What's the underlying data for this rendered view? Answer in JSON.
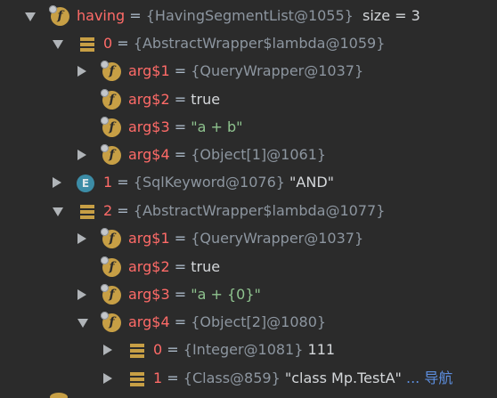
{
  "tree": {
    "rows": [
      {
        "name": "having",
        "eq": "=",
        "ref": "{HavingSegmentList@1055}",
        "extra": "size = 3"
      },
      {
        "name": "0",
        "eq": "=",
        "ref": "{AbstractWrapper$lambda@1059}"
      },
      {
        "name": "arg$1",
        "eq": "=",
        "ref": "{QueryWrapper@1037}"
      },
      {
        "name": "arg$2",
        "eq": "=",
        "value": "true"
      },
      {
        "name": "arg$3",
        "eq": "=",
        "value": "\"a + b\""
      },
      {
        "name": "arg$4",
        "eq": "=",
        "ref": "{Object[1]@1061}"
      },
      {
        "name": "1",
        "eq": "=",
        "ref": "{SqlKeyword@1076}",
        "value": "\"AND\""
      },
      {
        "name": "2",
        "eq": "=",
        "ref": "{AbstractWrapper$lambda@1077}"
      },
      {
        "name": "arg$1",
        "eq": "=",
        "ref": "{QueryWrapper@1037}"
      },
      {
        "name": "arg$2",
        "eq": "=",
        "value": "true"
      },
      {
        "name": "arg$3",
        "eq": "=",
        "value": "\"a + {0}\""
      },
      {
        "name": "arg$4",
        "eq": "=",
        "ref": "{Object[2]@1080}"
      },
      {
        "name": "0",
        "eq": "=",
        "ref": "{Integer@1081}",
        "value": "111"
      },
      {
        "name": "1",
        "eq": "=",
        "ref": "{Class@859}",
        "value": "\"class Mp.TestA\"",
        "ellipsis": "...",
        "nav": "导航"
      }
    ]
  },
  "icons": {
    "field_letter": "f",
    "enum_letter": "E"
  },
  "colors": {
    "background": "#2b2b2b",
    "variable_name": "#ff6b68",
    "reference": "#8d96a0",
    "string_value": "#8fc38f",
    "icon_gold": "#c79f45",
    "enum_icon": "#3c8ca6",
    "nav_link": "#5d8fe0"
  }
}
